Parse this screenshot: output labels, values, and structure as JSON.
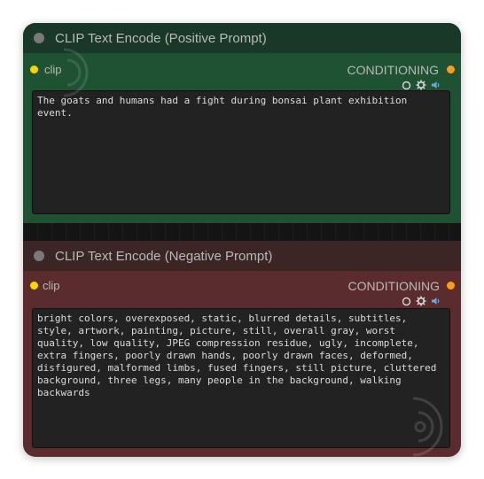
{
  "positive_node": {
    "title": "CLIP Text Encode (Positive Prompt)",
    "input_label": "clip",
    "output_label": "CONDITIONING",
    "text": "The goats and humans had a fight during bonsai plant exhibition event.",
    "color": "#1e5233"
  },
  "negative_node": {
    "title": "CLIP Text Encode (Negative Prompt)",
    "input_label": "clip",
    "output_label": "CONDITIONING",
    "text": "bright colors, overexposed, static, blurred details, subtitles, style, artwork, painting, picture, still, overall gray, worst quality, low quality, JPEG compression residue, ugly, incomplete, extra fingers, poorly drawn hands, poorly drawn faces, deformed, disfigured, malformed limbs, fused fingers, still picture, cluttered background, three legs, many people in the background, walking backwards",
    "color": "#5a2c2d"
  },
  "icons": [
    "circle-icon",
    "gear-icon",
    "speaker-icon"
  ],
  "colors": {
    "clip_socket": "#ffd500",
    "conditioning_socket": "#ff9c1a"
  }
}
